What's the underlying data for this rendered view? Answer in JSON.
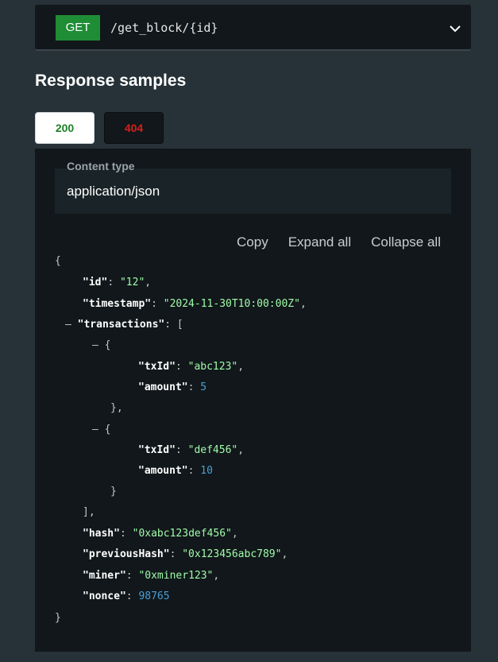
{
  "endpoint": {
    "method": "GET",
    "path": "/get_block/{id}",
    "chevron_icon": "chevron-down-icon"
  },
  "response_samples": {
    "title": "Response samples",
    "tabs": [
      {
        "label": "200",
        "color": "#1d8127",
        "active": true
      },
      {
        "label": "404",
        "color": "#d41f1c",
        "active": false
      }
    ]
  },
  "content_type": {
    "label": "Content type",
    "value": "application/json"
  },
  "actions": {
    "copy": "Copy",
    "expand_all": "Expand all",
    "collapse_all": "Collapse all"
  },
  "json": {
    "open_brace": "{",
    "close_brace": "}",
    "id_key": "\"id\"",
    "id_value": "\"12\"",
    "timestamp_key": "\"timestamp\"",
    "timestamp_value": "\"2024-11-30T10:00:00Z\"",
    "transactions_key": "\"transactions\"",
    "transactions": [
      {
        "txId_key": "\"txId\"",
        "txId_value": "\"abc123\"",
        "amount_key": "\"amount\"",
        "amount_value": "5"
      },
      {
        "txId_key": "\"txId\"",
        "txId_value": "\"def456\"",
        "amount_key": "\"amount\"",
        "amount_value": "10"
      }
    ],
    "hash_key": "\"hash\"",
    "hash_value": "\"0xabc123def456\"",
    "previousHash_key": "\"previousHash\"",
    "previousHash_value": "\"0x123456abc789\"",
    "miner_key": "\"miner\"",
    "miner_value": "\"0xminer123\"",
    "nonce_key": "\"nonce\"",
    "nonce_value": "98765"
  },
  "colors": {
    "page_bg": "#263238",
    "panel_bg": "#11171a",
    "get_method": "#1f8c36",
    "string": "#a0fbaa",
    "number": "#4a9fd6"
  }
}
